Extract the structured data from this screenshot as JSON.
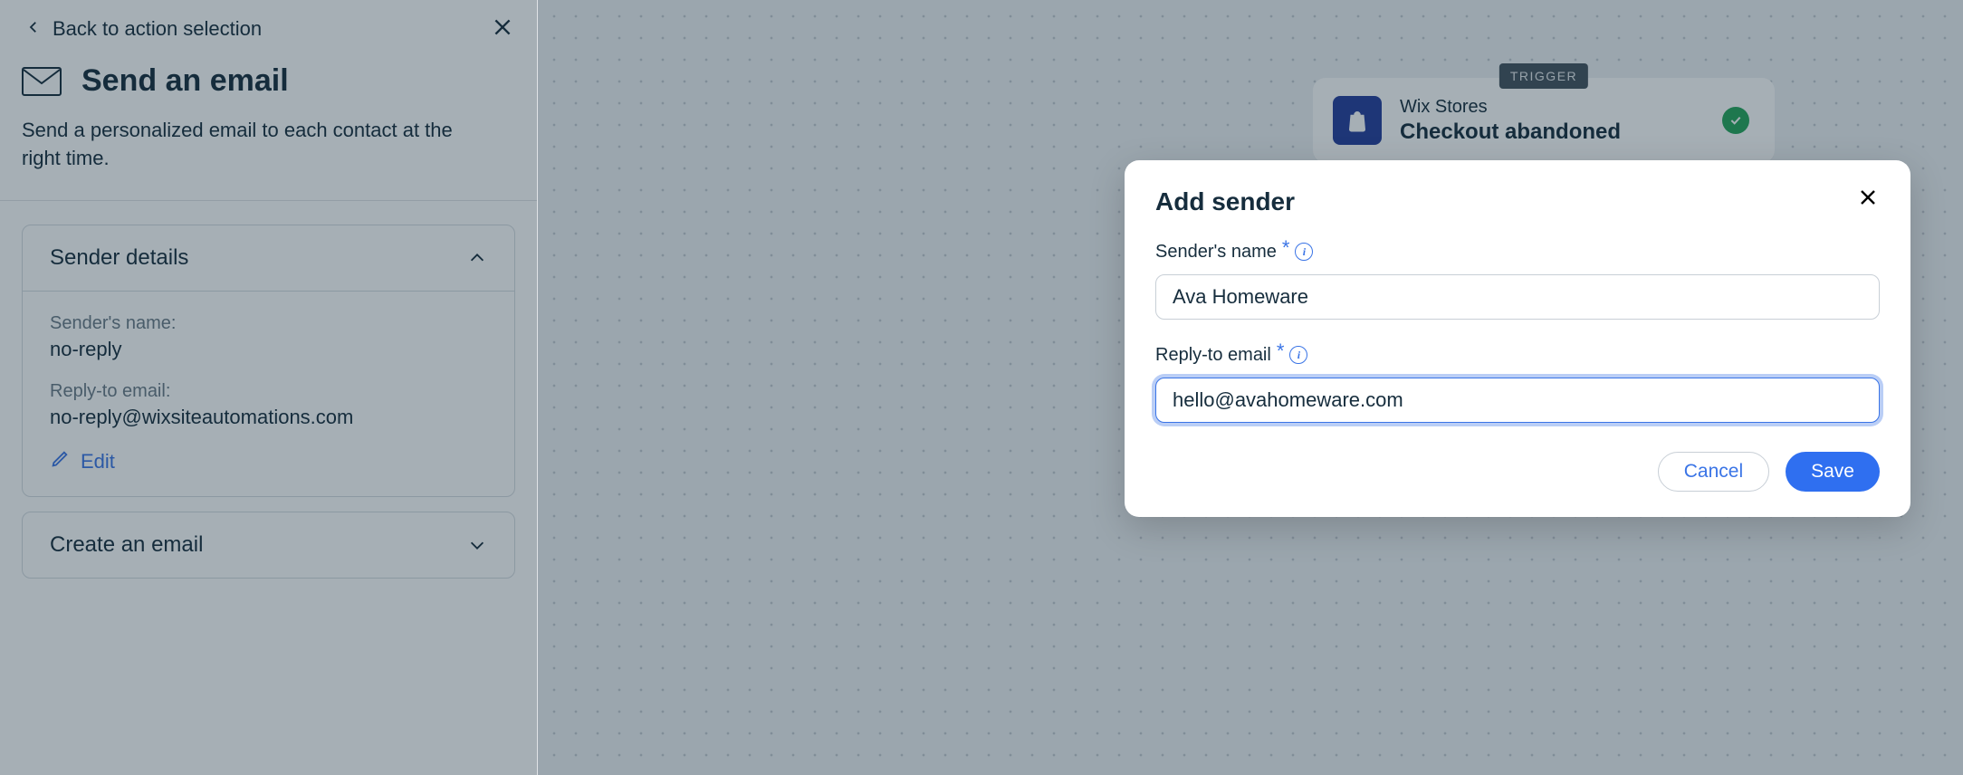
{
  "left": {
    "back_label": "Back to action selection",
    "title": "Send an email",
    "subtitle": "Send a personalized email to each contact at the right time.",
    "sections": {
      "sender": {
        "title": "Sender details",
        "sender_name_label": "Sender's name:",
        "sender_name_value": "no-reply",
        "reply_to_label": "Reply-to email:",
        "reply_to_value": "no-reply@wixsiteautomations.com",
        "edit_label": "Edit"
      },
      "create": {
        "title": "Create an email"
      }
    }
  },
  "canvas": {
    "trigger": {
      "badge": "TRIGGER",
      "app": "Wix Stores",
      "event": "Checkout abandoned"
    }
  },
  "modal": {
    "title": "Add sender",
    "fields": {
      "name": {
        "label": "Sender's name",
        "value": "Ava Homeware"
      },
      "email": {
        "label": "Reply-to email",
        "value": "hello@avahomeware.com"
      }
    },
    "actions": {
      "cancel": "Cancel",
      "save": "Save"
    }
  }
}
